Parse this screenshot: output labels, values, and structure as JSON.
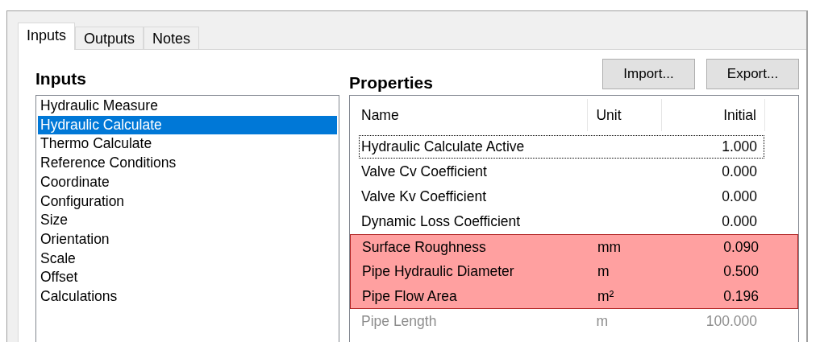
{
  "tabs": [
    {
      "label": "Inputs",
      "selected": true
    },
    {
      "label": "Outputs",
      "selected": false
    },
    {
      "label": "Notes",
      "selected": false
    }
  ],
  "inputs": {
    "heading": "Inputs",
    "items": [
      {
        "label": "Hydraulic Measure",
        "selected": false
      },
      {
        "label": "Hydraulic Calculate",
        "selected": true
      },
      {
        "label": "Thermo Calculate",
        "selected": false
      },
      {
        "label": "Reference Conditions",
        "selected": false
      },
      {
        "label": "Coordinate",
        "selected": false
      },
      {
        "label": "Configuration",
        "selected": false
      },
      {
        "label": "Size",
        "selected": false
      },
      {
        "label": "Orientation",
        "selected": false
      },
      {
        "label": "Scale",
        "selected": false
      },
      {
        "label": "Offset",
        "selected": false
      },
      {
        "label": "Calculations",
        "selected": false
      }
    ]
  },
  "properties": {
    "heading": "Properties",
    "buttons": [
      "Import...",
      "Export..."
    ],
    "columns": [
      "Name",
      "Unit",
      "Initial"
    ],
    "rows": [
      {
        "name": "Hydraulic Calculate Active",
        "unit": "",
        "initial": "1.000",
        "focused": true,
        "highlighted": false,
        "disabled": false
      },
      {
        "name": "Valve Cv Coefficient",
        "unit": "",
        "initial": "0.000",
        "focused": false,
        "highlighted": false,
        "disabled": false
      },
      {
        "name": "Valve Kv Coefficient",
        "unit": "",
        "initial": "0.000",
        "focused": false,
        "highlighted": false,
        "disabled": false
      },
      {
        "name": "Dynamic Loss Coefficient",
        "unit": "",
        "initial": "0.000",
        "focused": false,
        "highlighted": false,
        "disabled": false
      },
      {
        "name": "Surface Roughness",
        "unit": "mm",
        "initial": "0.090",
        "focused": false,
        "highlighted": true,
        "disabled": false
      },
      {
        "name": "Pipe Hydraulic Diameter",
        "unit": "m",
        "initial": "0.500",
        "focused": false,
        "highlighted": true,
        "disabled": false
      },
      {
        "name": "Pipe Flow Area",
        "unit": "m²",
        "initial": "0.196",
        "focused": false,
        "highlighted": true,
        "disabled": false
      },
      {
        "name": "Pipe Length",
        "unit": "m",
        "initial": "100.000",
        "focused": false,
        "highlighted": false,
        "disabled": true
      }
    ]
  }
}
